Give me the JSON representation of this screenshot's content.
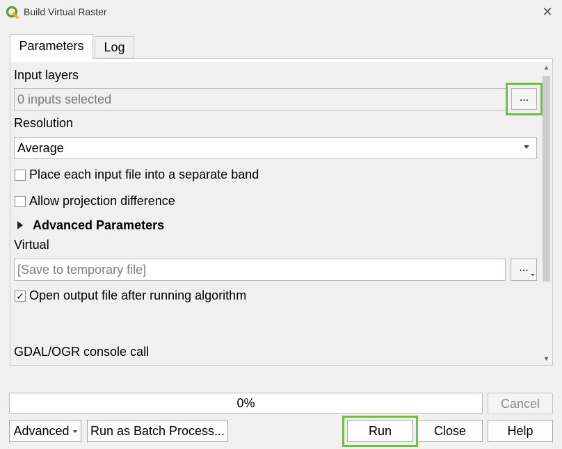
{
  "window": {
    "title": "Build Virtual Raster",
    "close_symbol": "✕"
  },
  "tabs": [
    {
      "label": "Parameters",
      "active": true
    },
    {
      "label": "Log",
      "active": false
    }
  ],
  "params": {
    "input_layers_label": "Input layers",
    "input_layers_value": "0 inputs selected",
    "input_browse_label": "...",
    "resolution_label": "Resolution",
    "resolution_value": "Average",
    "separate_band_label": "Place each input file into a separate band",
    "separate_band_checked": false,
    "allow_projection_label": "Allow projection difference",
    "allow_projection_checked": false,
    "advanced_label": "Advanced Parameters",
    "virtual_label": "Virtual",
    "virtual_placeholder": "[Save to temporary file]",
    "virtual_browse_label": "...",
    "open_output_label": "Open output file after running algorithm",
    "open_output_checked": true,
    "open_output_mark": "✓",
    "console_label": "GDAL/OGR console call"
  },
  "progress": {
    "value": 0,
    "text": "0%"
  },
  "buttons": {
    "cancel": "Cancel",
    "advanced": "Advanced",
    "batch": "Run as Batch Process...",
    "run": "Run",
    "close": "Close",
    "help": "Help"
  },
  "colors": {
    "highlight": "#70c040",
    "qgis_green": "#4e9a06"
  }
}
